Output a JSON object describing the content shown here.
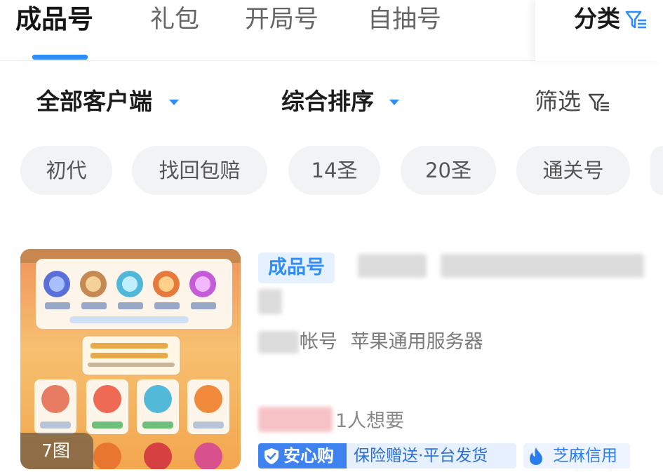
{
  "tabs": [
    {
      "label": "成品号",
      "active": true
    },
    {
      "label": "礼包",
      "active": false
    },
    {
      "label": "开局号",
      "active": false
    },
    {
      "label": "自抽号",
      "active": false
    }
  ],
  "category": {
    "label": "分类",
    "icon": "filter-icon"
  },
  "sort_bar": {
    "client": "全部客户端",
    "sort": "综合排序",
    "filter": "筛选"
  },
  "chips": [
    "初代",
    "找回包赔",
    "14圣",
    "20圣",
    "通关号"
  ],
  "product": {
    "tag": "成品号",
    "platform_suffix": "帐号",
    "server": "苹果通用服务器",
    "wants": "1人想要",
    "image_count": "7图",
    "anxin_label": "安心购",
    "anxin_desc": "保险赠送·平台发货",
    "zhima_label": "芝麻信用"
  },
  "colors": {
    "accent": "#2f8df7",
    "chip_bg": "#f2f3f5",
    "anxin_bg": "#3d82ee"
  }
}
